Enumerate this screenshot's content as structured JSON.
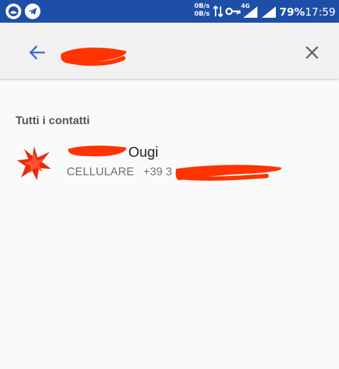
{
  "statusbar": {
    "netspeed_up": "0B/s",
    "netspeed_down": "0B/s",
    "network_type": "4G",
    "battery": "79%",
    "time": "17:59",
    "icons": [
      "notification-app-icon",
      "telegram-icon",
      "data-transfer-icon",
      "vpn-key-icon",
      "signal-icon",
      "signal-icon-2"
    ]
  },
  "toolbar": {
    "back_icon": "arrow-back-icon",
    "close_icon": "close-icon"
  },
  "section": {
    "header": "Tutti i contatti"
  },
  "contact": {
    "name_visible": "Ougi",
    "phone_type": "CELLULARE",
    "phone_prefix": "+39 3",
    "avatar_icon": "red-star-avatar-icon"
  },
  "colors": {
    "statusbar_bg": "#1e4fa8",
    "accent": "#3b6fd1",
    "redaction": "#ff3300"
  }
}
